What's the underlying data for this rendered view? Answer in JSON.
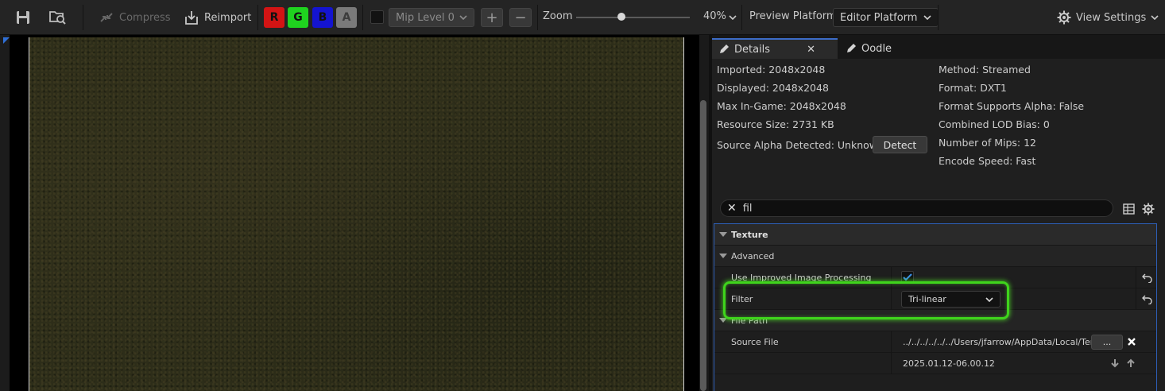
{
  "toolbar": {
    "compress_label": "Compress",
    "reimport_label": "Reimport",
    "channels": [
      {
        "label": "R",
        "color": "#d31414"
      },
      {
        "label": "G",
        "color": "#1fd31f"
      },
      {
        "label": "B",
        "color": "#1414d0"
      },
      {
        "label": "A",
        "color": "#7a7a7a"
      }
    ],
    "mip_level": "Mip Level 0",
    "zoom_label": "Zoom",
    "zoom_value": "40%",
    "zoom_fraction": 0.4,
    "preview_platform_label": "Preview Platform:",
    "preview_platform_value": "Editor Platform",
    "view_settings_label": "View Settings"
  },
  "panel": {
    "tabs": [
      {
        "label": "Details"
      },
      {
        "label": "Oodle"
      }
    ],
    "info_left": [
      "Imported: 2048x2048",
      "Displayed: 2048x2048",
      "Max In-Game: 2048x2048",
      "Resource Size: 2731 KB",
      "Source Alpha Detected: Unknown"
    ],
    "info_right": [
      "Method: Streamed",
      "Format: DXT1",
      "Format Supports Alpha: False",
      "Combined LOD Bias: 0",
      "Number of Mips: 12",
      "Encode Speed: Fast"
    ],
    "detect_label": "Detect",
    "search_value": "fil",
    "tree": {
      "texture_label": "Texture",
      "advanced_label": "Advanced",
      "improved_label": "Use Improved Image Processing",
      "improved_checked": true,
      "filter_label": "Filter",
      "filter_value": "Tri-linear",
      "file_path_label": "File Path",
      "source_file_label": "Source File",
      "source_file_value": "../../../../../../Users/jfarrow/AppData/Local/Ter",
      "browse_label": "...",
      "timestamp": "2025.01.12-06.00.12"
    }
  },
  "colors": {
    "accent": "#2d5fb8",
    "highlight": "#3fd41c",
    "check": "#3a8ee6"
  }
}
